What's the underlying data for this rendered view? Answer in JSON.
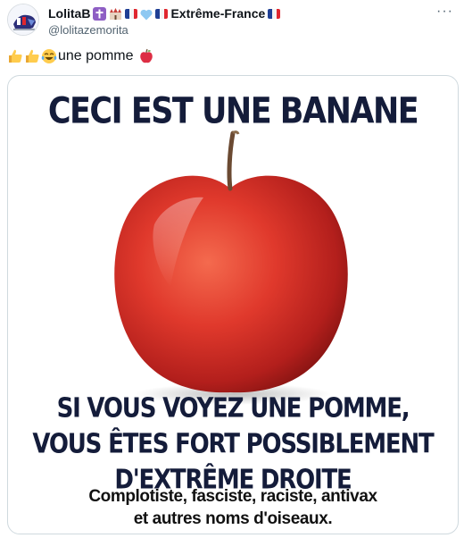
{
  "author": {
    "display_name_prefix": "LolitaB",
    "display_name_suffix": "Extrême-France",
    "handle": "@lolitazemorita"
  },
  "more_menu": "···",
  "tweet": {
    "text": "une pomme",
    "emojis_before": [
      "thumbs-up",
      "thumbs-up",
      "tears-of-joy"
    ],
    "emoji_after": "red-apple"
  },
  "meme": {
    "headline": "CECI EST UNE BANANE",
    "bottom_lines": [
      "SI VOUS VOYEZ UNE POMME,",
      "VOUS ÊTES FORT POSSIBLEMENT",
      "D'EXTRÊME DROITE"
    ],
    "subtext_lines": [
      "Complotiste, fasciste, raciste, antivax",
      "et autres noms d'oiseaux."
    ]
  },
  "colors": {
    "meme_text": "#141c3a",
    "apple_red": "#d8302a",
    "flag_blue": "#1f3f94",
    "flag_red": "#e0262e",
    "cross_purple": "#8e5ec4",
    "heart_light_blue": "#8ec8f2"
  }
}
